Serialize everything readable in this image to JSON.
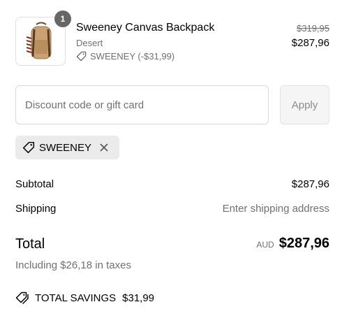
{
  "product": {
    "quantity": "1",
    "name": "Sweeney Canvas Backpack",
    "variant": "Desert",
    "discount_label": "SWEENEY (-$31,99)",
    "original_price": "$319,95",
    "price": "$287,96",
    "image_icon": "backpack-image"
  },
  "discount": {
    "placeholder": "Discount code or gift card",
    "value": "",
    "apply_label": "Apply",
    "applied_code": "SWEENEY",
    "tag_icon": "tag-icon",
    "remove_icon": "close-icon"
  },
  "summary": {
    "subtotal_label": "Subtotal",
    "subtotal_value": "$287,96",
    "shipping_label": "Shipping",
    "shipping_value": "Enter shipping address",
    "total_label": "Total",
    "currency": "AUD",
    "total_value": "$287,96",
    "taxes_note": "Including $26,18 in taxes",
    "savings_label": "TOTAL SAVINGS",
    "savings_value": "$31,99",
    "savings_icon": "tags-icon"
  },
  "colors": {
    "text": "#000000",
    "muted": "#707070",
    "badge": "#666666",
    "pill": "#ebebeb",
    "border": "#d9d9d9"
  }
}
